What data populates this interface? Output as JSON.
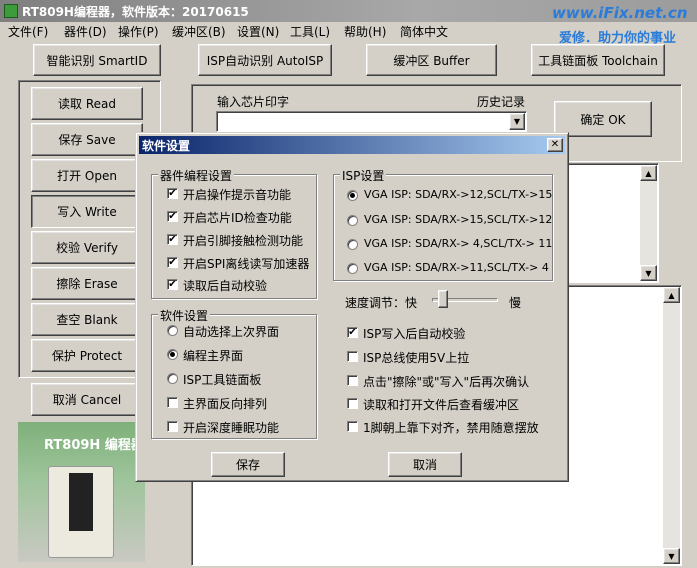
{
  "titlebar": {
    "title": "RT809H编程器，软件版本：20170615"
  },
  "brand": {
    "url": "www.iFix.net.cn",
    "slogan": "爱修．助力你的事业"
  },
  "menu": [
    {
      "label": "文件(F)"
    },
    {
      "label": "器件(D)"
    },
    {
      "label": "操作(P)"
    },
    {
      "label": "缓冲区(B)"
    },
    {
      "label": "设置(N)"
    },
    {
      "label": "工具(L)"
    },
    {
      "label": "帮助(H)"
    },
    {
      "label": "简体中文"
    }
  ],
  "toolbar": {
    "smartid": "智能识别 SmartID",
    "autoisp": "ISP自动识别 AutoISP",
    "buffer": "缓冲区 Buffer",
    "toolchain": "工具链面板 Toolchain"
  },
  "left_buttons": [
    {
      "label": "读取 Read"
    },
    {
      "label": "保存 Save"
    },
    {
      "label": "打开 Open"
    },
    {
      "label": "写入 Write"
    },
    {
      "label": "校验 Verify"
    },
    {
      "label": "擦除 Erase"
    },
    {
      "label": "查空 Blank"
    },
    {
      "label": "保护 Protect"
    },
    {
      "label": "取消 Cancel"
    }
  ],
  "product": {
    "label": "RT809H 编程器"
  },
  "chip_input": {
    "label": "输入芯片印字",
    "history_label": "历史记录",
    "value": ""
  },
  "confirm_button": "确定 OK",
  "dialog": {
    "title": "软件设置",
    "close": "✕",
    "device_group": {
      "title": "器件编程设置",
      "items": [
        {
          "label": "开启操作提示音功能",
          "checked": true
        },
        {
          "label": "开启芯片ID检查功能",
          "checked": true
        },
        {
          "label": "开启引脚接触检测功能",
          "checked": true
        },
        {
          "label": "开启SPI离线读写加速器",
          "checked": true
        },
        {
          "label": "读取后自动校验",
          "checked": true
        }
      ]
    },
    "software_group": {
      "title": "软件设置",
      "radios": [
        {
          "label": "自动选择上次界面",
          "selected": false
        },
        {
          "label": "编程主界面",
          "selected": true
        },
        {
          "label": "ISP工具链面板",
          "selected": false
        }
      ],
      "checks": [
        {
          "label": "主界面反向排列",
          "checked": false
        },
        {
          "label": "开启深度睡眠功能",
          "checked": false
        }
      ]
    },
    "isp_group": {
      "title": "ISP设置",
      "options": [
        {
          "label": "VGA ISP: SDA/RX->12,SCL/TX->15",
          "selected": true
        },
        {
          "label": "VGA ISP: SDA/RX->15,SCL/TX->12",
          "selected": false
        },
        {
          "label": "VGA ISP: SDA/RX-> 4,SCL/TX-> 11",
          "selected": false
        },
        {
          "label": "VGA ISP: SDA/RX->11,SCL/TX-> 4",
          "selected": false
        }
      ]
    },
    "speed": {
      "label": "速度调节：快",
      "slow": "慢",
      "value": 0.1
    },
    "right_checks": [
      {
        "label": "ISP写入后自动校验",
        "checked": true
      },
      {
        "label": "ISP总线使用5V上拉",
        "checked": false
      },
      {
        "label": "点击\"擦除\"或\"写入\"后再次确认",
        "checked": false
      },
      {
        "label": "读取和打开文件后查看缓冲区",
        "checked": false
      },
      {
        "label": "1脚朝上靠下对齐，禁用随意摆放",
        "checked": false
      }
    ],
    "save": "保存",
    "cancel": "取消"
  },
  "colors": {
    "accent_blue": "#2a7cd8",
    "dialog_title": "#0a246a",
    "window_bg": "#d4d0c8"
  }
}
